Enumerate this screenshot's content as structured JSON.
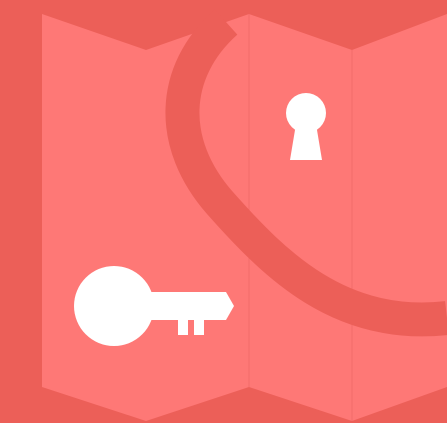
{
  "colors": {
    "background": "#ec5f58",
    "map_panel": "#fe7876",
    "path": "#ec5f58",
    "fold_line": "#f36c69",
    "icon_fill": "#ffffff"
  },
  "icons": {
    "key": "key-icon",
    "keyhole": "keyhole-icon"
  }
}
